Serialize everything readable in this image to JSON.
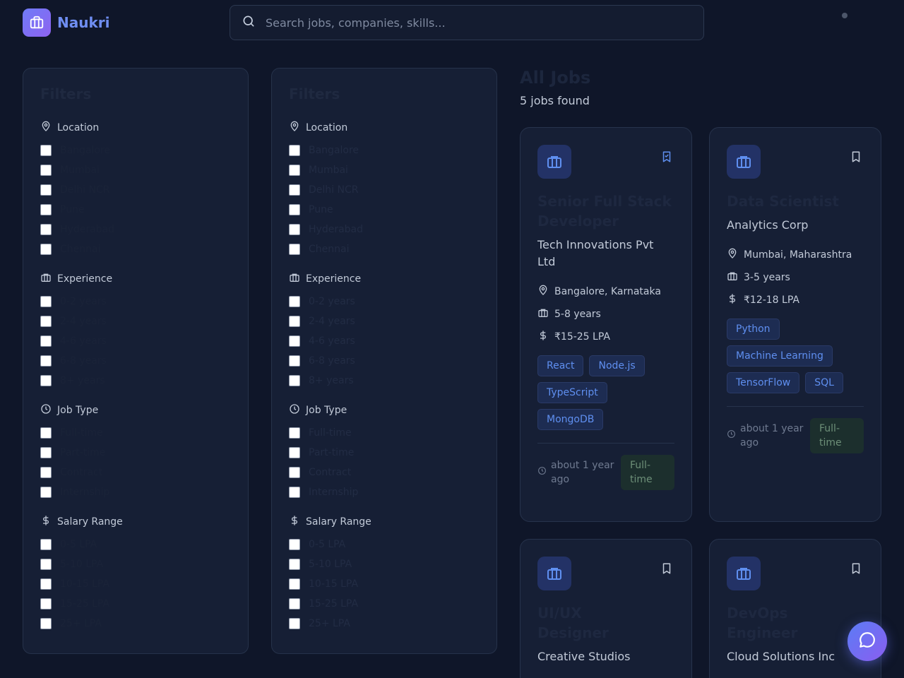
{
  "app": {
    "name": "Naukri"
  },
  "search": {
    "placeholder": "Search jobs, companies, skills..."
  },
  "filters": {
    "panels": [
      {
        "title": "Filters"
      },
      {
        "title": "Filters"
      }
    ],
    "location": {
      "label": "Location",
      "options": [
        "Bangalore",
        "Mumbai",
        "Delhi NCR",
        "Pune",
        "Hyderabad",
        "Chennai"
      ]
    },
    "experience": {
      "label": "Experience",
      "options": [
        "0-2 years",
        "2-4 years",
        "4-6 years",
        "6-8 years",
        "8+ years"
      ]
    },
    "job_type": {
      "label": "Job Type",
      "options": [
        "Full-time",
        "Part-time",
        "Contract",
        "Internship"
      ]
    },
    "salary": {
      "label": "Salary Range",
      "options": [
        "0-5 LPA",
        "5-10 LPA",
        "10-15 LPA",
        "15-25 LPA",
        "25+ LPA"
      ]
    }
  },
  "jobs": {
    "title": "All Jobs",
    "count_text": "5 jobs found",
    "cards": [
      {
        "title": "Senior Full Stack Developer",
        "company": "Tech Innovations Pvt Ltd",
        "location": "Bangalore, Karnataka",
        "experience": "5-8 years",
        "salary": "₹15-25 LPA",
        "skills": [
          "React",
          "Node.js",
          "TypeScript",
          "MongoDB"
        ],
        "posted": "about 1 year ago",
        "type": "Full-time"
      },
      {
        "title": "Data Scientist",
        "company": "Analytics Corp",
        "location": "Mumbai, Maharashtra",
        "experience": "3-5 years",
        "salary": "₹12-18 LPA",
        "skills": [
          "Python",
          "Machine Learning",
          "TensorFlow",
          "SQL"
        ],
        "posted": "about 1 year ago",
        "type": "Full-time"
      },
      {
        "title": "UI/UX Designer",
        "company": "Creative Studios"
      },
      {
        "title": "DevOps Engineer",
        "company": "Cloud Solutions Inc"
      }
    ]
  },
  "colors": {
    "accent": "#6f8ef2",
    "background": "#0f1629",
    "card": "#161f35"
  },
  "icons": [
    "briefcase-icon",
    "search-icon",
    "map-pin-icon",
    "clock-icon",
    "dollar-icon",
    "bookmark-icon",
    "chat-icon"
  ]
}
